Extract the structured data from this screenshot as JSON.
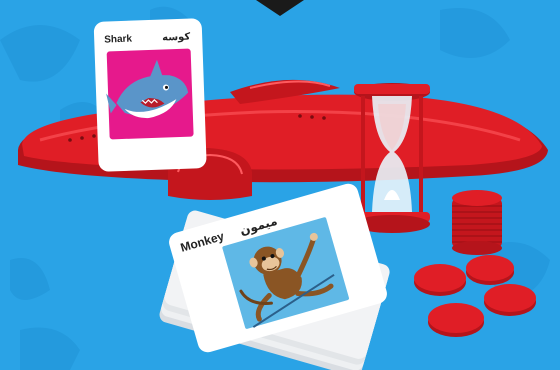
{
  "scene": {
    "description_colors": {
      "background": "#2aa3e6",
      "background_shape": "#239be0",
      "headband_red": "#e01e26",
      "headband_dark": "#b5141b",
      "card_white": "#ffffff",
      "shark_card_bg": "#e6198c",
      "monkey_card_bg": "#5fb8e6"
    }
  },
  "cards": {
    "shark": {
      "label_en": "Shark",
      "label_ar": "كوسه",
      "icon": "shark-illustration"
    },
    "monkey": {
      "label_en": "Monkey",
      "label_ar": "ميمون",
      "icon": "monkey-illustration"
    }
  },
  "props": {
    "hourglass": {
      "icon": "hourglass-timer"
    },
    "chips": {
      "icon": "red-token-chips"
    },
    "headband": {
      "icon": "headband"
    }
  }
}
